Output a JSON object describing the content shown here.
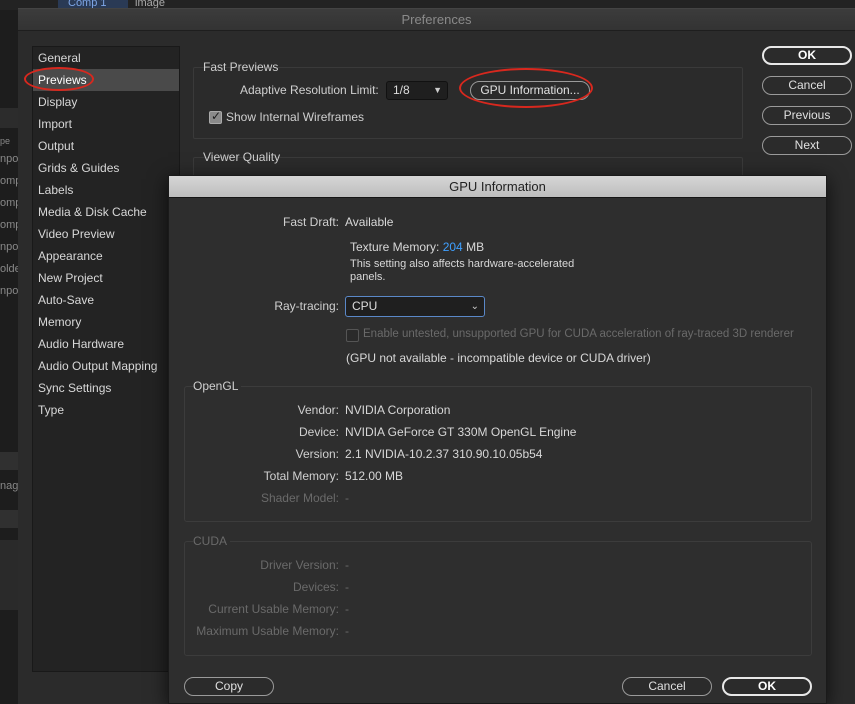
{
  "background": {
    "tab_label": "Comp 1",
    "tab_label_2": "image",
    "left_fragments": [
      "pe",
      "npo",
      "omp",
      "omp",
      "omp",
      "npo",
      "olde",
      "npo"
    ],
    "left_fragment_mid": "nage"
  },
  "preferences": {
    "title": "Preferences",
    "sidebar": [
      {
        "label": "General"
      },
      {
        "label": "Previews",
        "selected": true
      },
      {
        "label": "Display"
      },
      {
        "label": "Import"
      },
      {
        "label": "Output"
      },
      {
        "label": "Grids & Guides"
      },
      {
        "label": "Labels"
      },
      {
        "label": "Media & Disk Cache"
      },
      {
        "label": "Video Preview"
      },
      {
        "label": "Appearance"
      },
      {
        "label": "New Project"
      },
      {
        "label": "Auto-Save"
      },
      {
        "label": "Memory"
      },
      {
        "label": "Audio Hardware"
      },
      {
        "label": "Audio Output Mapping"
      },
      {
        "label": "Sync Settings"
      },
      {
        "label": "Type"
      }
    ],
    "fast_previews": {
      "group_label": "Fast Previews",
      "adaptive_label": "Adaptive Resolution Limit:",
      "adaptive_value": "1/8",
      "gpu_info_button": "GPU Information...",
      "wireframes_label": "Show Internal Wireframes",
      "wireframes_checked": true
    },
    "viewer_quality": {
      "group_label": "Viewer Quality"
    },
    "buttons": {
      "ok": "OK",
      "cancel": "Cancel",
      "previous": "Previous",
      "next": "Next"
    }
  },
  "gpu_dialog": {
    "title": "GPU Information",
    "fast_draft_label": "Fast Draft:",
    "fast_draft_value": "Available",
    "texture_memory_label": "Texture Memory:",
    "texture_memory_value": "204",
    "texture_memory_unit": "MB",
    "note_line1": "This setting also affects hardware-accelerated",
    "note_line2": "panels.",
    "ray_tracing_label": "Ray-tracing:",
    "ray_tracing_value": "CPU",
    "cuda_checkbox_label": "Enable untested, unsupported GPU for CUDA acceleration of ray-traced 3D renderer",
    "cuda_checkbox_checked": false,
    "gpu_note": "(GPU not available - incompatible device or CUDA driver)",
    "opengl": {
      "group_label": "OpenGL",
      "vendor_label": "Vendor:",
      "vendor_value": "NVIDIA Corporation",
      "device_label": "Device:",
      "device_value": "NVIDIA GeForce GT 330M OpenGL Engine",
      "version_label": "Version:",
      "version_value": "2.1 NVIDIA-10.2.37 310.90.10.05b54",
      "total_memory_label": "Total Memory:",
      "total_memory_value": "512.00 MB",
      "shader_model_label": "Shader Model:",
      "shader_model_value": "-"
    },
    "cuda": {
      "group_label": "CUDA",
      "driver_version_label": "Driver Version:",
      "driver_version_value": "-",
      "devices_label": "Devices:",
      "devices_value": "-",
      "current_usable_memory_label": "Current Usable Memory:",
      "current_usable_memory_value": "-",
      "maximum_usable_memory_label": "Maximum Usable Memory:",
      "maximum_usable_memory_value": "-"
    },
    "buttons": {
      "copy": "Copy",
      "cancel": "Cancel",
      "ok": "OK"
    }
  },
  "colors": {
    "accent_blue": "#3fa0ff",
    "annotation_red": "#d8281e",
    "dialog_bg": "#2e2e2e"
  }
}
